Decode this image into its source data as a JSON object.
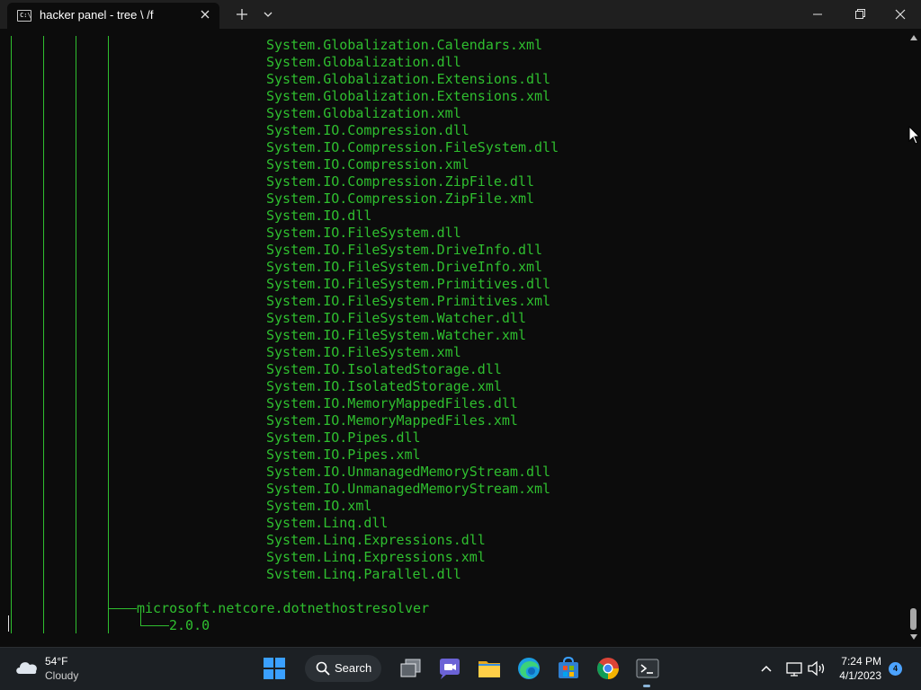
{
  "window": {
    "tab_title": "hacker panel - tree  \\ /f",
    "new_tab": "+",
    "colors": {
      "terminal_bg": "#0c0c0c",
      "text_green": "#2fbf2f",
      "titlebar_bg": "#1f1f1f"
    }
  },
  "terminal": {
    "files": [
      "System.Globalization.Calendars.xml",
      "System.Globalization.dll",
      "System.Globalization.Extensions.dll",
      "System.Globalization.Extensions.xml",
      "System.Globalization.xml",
      "System.IO.Compression.dll",
      "System.IO.Compression.FileSystem.dll",
      "System.IO.Compression.xml",
      "System.IO.Compression.ZipFile.dll",
      "System.IO.Compression.ZipFile.xml",
      "System.IO.dll",
      "System.IO.FileSystem.dll",
      "System.IO.FileSystem.DriveInfo.dll",
      "System.IO.FileSystem.DriveInfo.xml",
      "System.IO.FileSystem.Primitives.dll",
      "System.IO.FileSystem.Primitives.xml",
      "System.IO.FileSystem.Watcher.dll",
      "System.IO.FileSystem.Watcher.xml",
      "System.IO.FileSystem.xml",
      "System.IO.IsolatedStorage.dll",
      "System.IO.IsolatedStorage.xml",
      "System.IO.MemoryMappedFiles.dll",
      "System.IO.MemoryMappedFiles.xml",
      "System.IO.Pipes.dll",
      "System.IO.Pipes.xml",
      "System.IO.UnmanagedMemoryStream.dll",
      "System.IO.UnmanagedMemoryStream.xml",
      "System.IO.xml",
      "System.Linq.dll",
      "System.Linq.Expressions.dll",
      "System.Linq.Expressions.xml",
      "Svstem.Linq.Parallel.dll"
    ],
    "folder": "microsoft.netcore.dotnethostresolver",
    "subfolder": "2.0.0"
  },
  "taskbar": {
    "weather_temp": "54°F",
    "weather_condition": "Cloudy",
    "search_label": "Search",
    "time": "7:24 PM",
    "date": "4/1/2023",
    "notification_count": "4",
    "icons": [
      "start-icon",
      "search-icon",
      "task-view-icon",
      "teams-chat-icon",
      "file-explorer-icon",
      "edge-icon",
      "store-icon",
      "chrome-icon",
      "terminal-icon"
    ],
    "tray_icons": [
      "chevron-up-icon",
      "network-icon",
      "volume-icon"
    ]
  }
}
